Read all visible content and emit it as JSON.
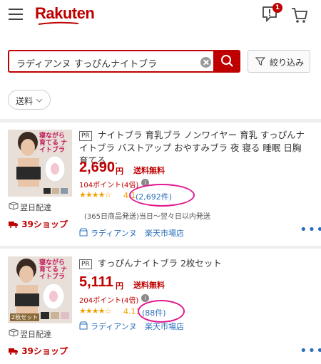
{
  "header": {
    "logo": "Rakuten",
    "notification_count": "1"
  },
  "search": {
    "query": "ラディアンヌ すっぴんナイトブラ",
    "filter_label": "絞り込み",
    "shipping_chip": "送料"
  },
  "products": [
    {
      "pr": "PR",
      "title": "ナイトブラ 育乳ブラ ノンワイヤー 育乳 すっぴんナイトブラ バストアップ おやすみブラ 夜 寝る 睡眠 日胸 育てる …",
      "price": "2,690",
      "yen": "円",
      "shipping": "送料無料",
      "points": "104ポイント(4倍)",
      "stars": "★★★★☆",
      "rating": "4.1",
      "reviews": "(2,692件)",
      "delivery": "(365日商品発送)当日〜翌々日以内発送",
      "shop": "ラディアンヌ",
      "market": "楽天市場店",
      "next_day": "翌日配達",
      "shop39": "39ショップ",
      "thumb_text": "寝ながら育てる ナイトブラ"
    },
    {
      "pr": "PR",
      "title": "すっぴんナイトブラ 2枚セット",
      "price": "5,111",
      "yen": "円",
      "shipping": "送料無料",
      "points": "204ポイント(4倍)",
      "stars": "★★★★☆",
      "rating": "4.11",
      "reviews": "(88件)",
      "shop": "ラディアンヌ",
      "market": "楽天市場店",
      "next_day": "翌日配達",
      "shop39": "39ショップ",
      "thumb_text": "寝ながら育てる ナイトブラ",
      "thumb_badge": "2枚セット"
    }
  ],
  "colors": {
    "brand": "#bf0000",
    "link": "#2a6ebb",
    "star": "#f2a100",
    "annotation": "#e0198f"
  }
}
